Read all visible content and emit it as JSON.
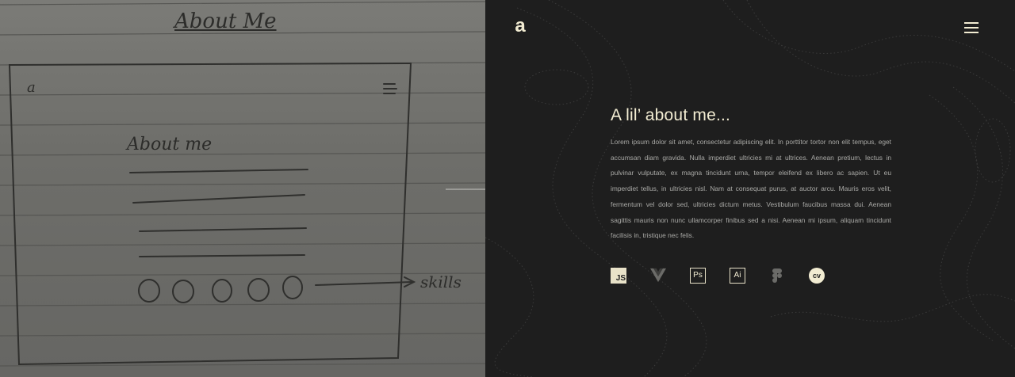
{
  "sketch": {
    "title": "About Me",
    "logo_letter": "a",
    "heading": "About me",
    "note": "skills"
  },
  "mock": {
    "logo": "a",
    "menu_icon": "hamburger-menu-icon",
    "heading": "A lil’ about me...",
    "paragraph": "Lorem ipsum dolor sit amet, consectetur adipiscing elit. In porttitor tortor non elit tempus, eget accumsan diam gravida. Nulla imperdiet ultricies mi at ultrices. Aenean pretium, lectus in pulvinar vulputate, ex magna tincidunt urna, tempor eleifend ex libero ac sapien. Ut eu imperdiet tellus, in ultricies nisl. Nam at consequat purus, at auctor arcu. Mauris eros velit, fermentum vel dolor sed, ultricies dictum metus. Vestibulum faucibus massa dui. Aenean sagittis mauris non nunc ullamcorper finibus sed a nisi. Aenean mi ipsum, aliquam tincidunt facilisis in, tristique nec felis.",
    "skills": [
      {
        "label": "JS",
        "icon": "javascript-icon"
      },
      {
        "label": "",
        "icon": "vue-icon"
      },
      {
        "label": "Ps",
        "icon": "photoshop-icon"
      },
      {
        "label": "Ai",
        "icon": "illustrator-icon"
      },
      {
        "label": "",
        "icon": "figma-icon"
      },
      {
        "label": "cv",
        "icon": "cv-icon"
      }
    ]
  },
  "colors": {
    "accent": "#f2ecd2",
    "background": "#1e1e1e",
    "text_muted": "#a9a9a6"
  }
}
